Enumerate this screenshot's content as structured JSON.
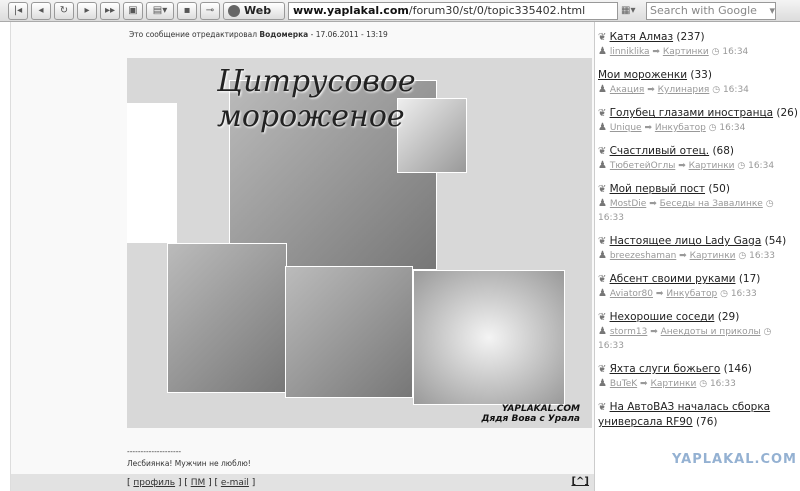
{
  "toolbar": {
    "web_label": "Web",
    "url_domain": "www.yaplakal.com",
    "url_path": "/forum30/st/0/topic335402.html",
    "search_placeholder": "Search with Google"
  },
  "post": {
    "edited_prefix": "Это сообщение отредактировал",
    "edited_by": "Водомерка",
    "edited_date": "- 17.06.2011 - 13:19",
    "image_title": "Цитрусовое мороженое",
    "image_watermark": "YAPLAKAL.COM",
    "image_signature": "Дядя Вова с Урала",
    "sig_divider": "--------------------",
    "signature": "Лесбиянка! Мужчин не люблю!",
    "links": [
      "профиль",
      "ПМ",
      "e-mail"
    ],
    "top_label": "[^]"
  },
  "sidebar": {
    "items": [
      {
        "title": "Катя Алмаз",
        "count": "(237)",
        "author": "linniklika",
        "section": "Картинки",
        "time": "16:34",
        "icon": true
      },
      {
        "title": "Мои мороженки",
        "count": "(33)",
        "author": "Акация",
        "section": "Кулинария",
        "time": "16:34",
        "icon": false
      },
      {
        "title": "Голубец глазами иностранца",
        "count": "(26)",
        "author": "Unique",
        "section": "Инкубатор",
        "time": "16:34",
        "icon": true
      },
      {
        "title": "Счастливый отец.",
        "count": "(68)",
        "author": "ТюбетейОглы",
        "section": "Картинки",
        "time": "16:34",
        "icon": true
      },
      {
        "title": "Мой первый пост",
        "count": "(50)",
        "author": "MostDie",
        "section": "Беседы на Завалинке",
        "time": "16:33",
        "icon": true
      },
      {
        "title": "Настоящее лицо Lady Gaga",
        "count": "(54)",
        "author": "breezeshaman",
        "section": "Картинки",
        "time": "16:33",
        "icon": true
      },
      {
        "title": "Абсент своими руками",
        "count": "(17)",
        "author": "Aviator80",
        "section": "Инкубатор",
        "time": "16:33",
        "icon": true
      },
      {
        "title": "Нехорошие соседи",
        "count": "(29)",
        "author": "storm13",
        "section": "Анекдоты и приколы",
        "time": "16:33",
        "icon": true
      },
      {
        "title": "Яхта слуги божьего",
        "count": "(146)",
        "author": "BuTeK",
        "section": "Картинки",
        "time": "16:33",
        "icon": true
      },
      {
        "title": "На АвтоВАЗ началась сборка универсала RF90",
        "count": "(76)",
        "author": "",
        "section": "",
        "time": "",
        "icon": true
      }
    ],
    "watermark": "YAPLAKAL.COM"
  }
}
